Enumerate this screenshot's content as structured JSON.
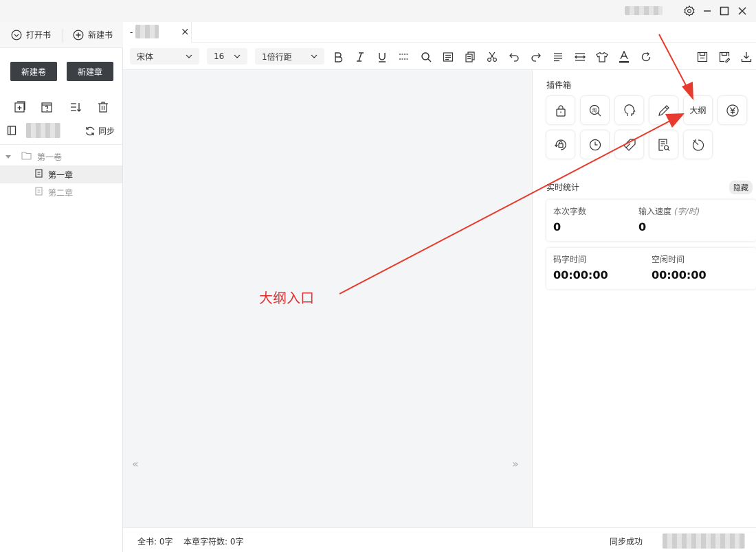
{
  "titlebar": {
    "icons": [
      "gear-icon",
      "minimize-icon",
      "maximize-icon",
      "close-icon"
    ]
  },
  "left_panel": {
    "open_book": "打开书",
    "new_book": "新建书",
    "new_volume": "新建卷",
    "new_chapter": "新建章",
    "sync": "同步",
    "tree": [
      {
        "label": "第一卷",
        "type": "volume"
      },
      {
        "label": "第一章",
        "type": "chapter",
        "selected": true
      },
      {
        "label": "第二章",
        "type": "chapter",
        "selected": false
      }
    ]
  },
  "tab": {
    "title": "-",
    "close": "×"
  },
  "toolbar": {
    "font": "宋体",
    "size": "16",
    "line_spacing": "1倍行距"
  },
  "plugins": {
    "title": "插件箱",
    "outline_label": "大纲"
  },
  "stats": {
    "title": "实时统计",
    "hide": "隐藏",
    "session_words_label": "本次字数",
    "session_words": "0",
    "speed_label": "输入速度",
    "speed_unit": "(字/时)",
    "speed": "0",
    "typing_time_label": "码字时间",
    "typing_time": "00:00:00",
    "idle_time_label": "空闲时间",
    "idle_time": "00:00:00"
  },
  "editor": {
    "prev": "«",
    "next": "»"
  },
  "status": {
    "book_total": "全书: 0字",
    "chapter_chars": "本章字符数: 0字",
    "sync_status": "同步成功"
  },
  "annotation": {
    "text": "大纲入口",
    "color": "#e03131"
  }
}
